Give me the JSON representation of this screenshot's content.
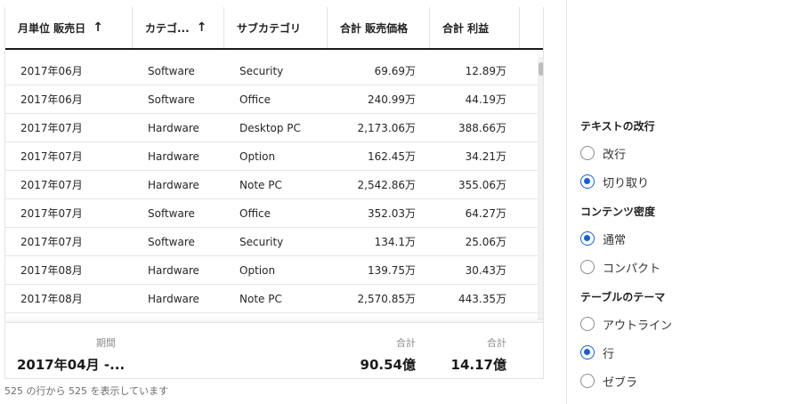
{
  "table": {
    "columns": [
      {
        "label": "月単位 販売日",
        "sort_icon": "arrow-up-icon",
        "sort_glyph": "↑"
      },
      {
        "label": "カテゴ...",
        "sort_icon": "arrow-up-icon",
        "sort_glyph": "↑"
      },
      {
        "label": "サブカテゴリ"
      },
      {
        "label": "合計 販売価格"
      },
      {
        "label": "合計 利益"
      }
    ],
    "rows": [
      [
        "2017年06月",
        "Software",
        "Security",
        "69.69万",
        "12.89万"
      ],
      [
        "2017年06月",
        "Software",
        "Office",
        "240.99万",
        "44.19万"
      ],
      [
        "2017年07月",
        "Hardware",
        "Desktop PC",
        "2,173.06万",
        "388.66万"
      ],
      [
        "2017年07月",
        "Hardware",
        "Option",
        "162.45万",
        "34.21万"
      ],
      [
        "2017年07月",
        "Hardware",
        "Note PC",
        "2,542.86万",
        "355.06万"
      ],
      [
        "2017年07月",
        "Software",
        "Office",
        "352.03万",
        "64.27万"
      ],
      [
        "2017年07月",
        "Software",
        "Security",
        "134.1万",
        "25.06万"
      ],
      [
        "2017年08月",
        "Hardware",
        "Option",
        "139.75万",
        "30.43万"
      ],
      [
        "2017年08月",
        "Hardware",
        "Note PC",
        "2,570.85万",
        "443.35万"
      ]
    ],
    "footer": {
      "period_label": "期間",
      "period_value": "2017年04月 -...",
      "total_label_1": "合計",
      "total_value_1": "90.54億",
      "total_label_2": "合計",
      "total_value_2": "14.17億"
    },
    "status": "525 の行から 525 を表示しています"
  },
  "panel": {
    "text_wrap": {
      "title": "テキストの改行",
      "options": [
        {
          "label": "改行",
          "selected": false
        },
        {
          "label": "切り取り",
          "selected": true
        }
      ]
    },
    "density": {
      "title": "コンテンツ密度",
      "options": [
        {
          "label": "通常",
          "selected": true
        },
        {
          "label": "コンパクト",
          "selected": false
        }
      ]
    },
    "theme": {
      "title": "テーブルのテーマ",
      "options": [
        {
          "label": "アウトライン",
          "selected": false
        },
        {
          "label": "行",
          "selected": true
        },
        {
          "label": "ゼブラ",
          "selected": false
        }
      ]
    }
  },
  "colors": {
    "accent": "#1a5fd0",
    "header_rule": "#1a1a1a",
    "row_border": "#e6e6e6"
  }
}
